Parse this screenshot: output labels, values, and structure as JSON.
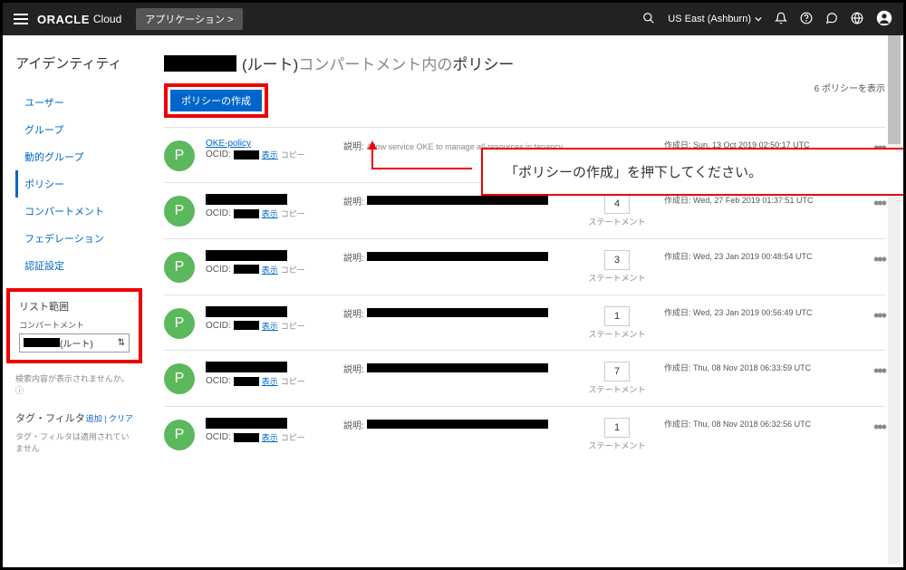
{
  "header": {
    "brand": "ORACLE",
    "brand_sub": "Cloud",
    "app_button": "アプリケーション >",
    "region": "US East (Ashburn)"
  },
  "sidebar": {
    "title": "アイデンティティ",
    "nav": [
      {
        "label": "ユーザー"
      },
      {
        "label": "グループ"
      },
      {
        "label": "動的グループ"
      },
      {
        "label": "ポリシー"
      },
      {
        "label": "コンパートメント"
      },
      {
        "label": "フェデレーション"
      },
      {
        "label": "認証設定"
      }
    ],
    "scope": {
      "title": "リスト範囲",
      "label": "コンパートメント",
      "value_suffix": "(ルート)",
      "note": "検索内容が表示されませんか。"
    },
    "tag_filter": {
      "title": "タグ・フィルタ",
      "actions": "追加 | クリア",
      "note": "タグ・フィルタは適用されていません"
    }
  },
  "page": {
    "title_suffix": "(ルート)",
    "title_mid": "コンパートメント内の",
    "title_end": "ポリシー",
    "count_text": "6 ポリシーを表示",
    "create_button": "ポリシーの作成",
    "callout": "「ポリシーの作成」を押下してください。"
  },
  "labels": {
    "ocid": "OCID:",
    "show": "表示",
    "copy": "コピー",
    "description": "説明:",
    "statement": "ステートメント",
    "created": "作成日:"
  },
  "policies": [
    {
      "name": "OKE-policy",
      "name_link": true,
      "desc_text": "Allow service OKE to manage all-resources in tenancy",
      "stmt": "",
      "created": "Sun, 13 Oct 2019 02:50:17 UTC"
    },
    {
      "name": "",
      "stmt": "4",
      "created": "Wed, 27 Feb 2019 01:37:51 UTC"
    },
    {
      "name": "",
      "stmt": "3",
      "created": "Wed, 23 Jan 2019 00:48:54 UTC"
    },
    {
      "name": "",
      "stmt": "1",
      "created": "Wed, 23 Jan 2019 00:56:49 UTC"
    },
    {
      "name": "",
      "stmt": "7",
      "created": "Thu, 08 Nov 2018 06:33:59 UTC"
    },
    {
      "name": "",
      "stmt": "1",
      "created": "Thu, 08 Nov 2018 06:32:56 UTC"
    }
  ]
}
